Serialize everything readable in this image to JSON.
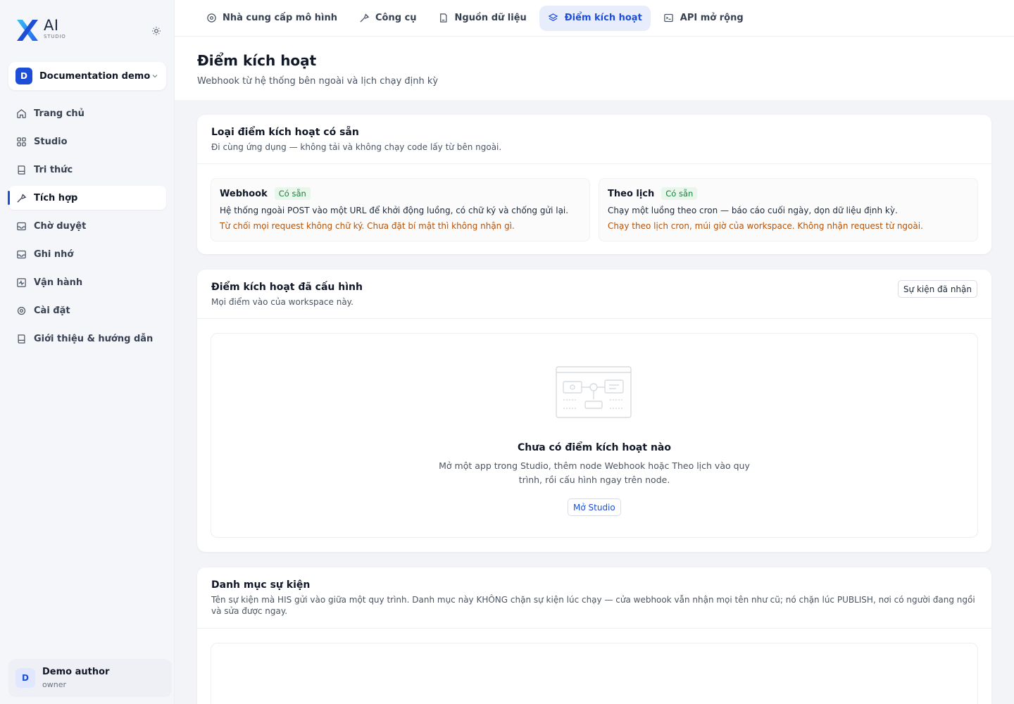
{
  "brand": {
    "name": "AI",
    "sub": "STUDIO"
  },
  "icons": {
    "theme": "sun-icon",
    "chevron": "chevron-down-icon"
  },
  "workspace": {
    "initial": "D",
    "name": "Documentation demo"
  },
  "sidebar": {
    "items": [
      {
        "label": "Trang chủ",
        "icon": "home-icon"
      },
      {
        "label": "Studio",
        "icon": "grid-icon"
      },
      {
        "label": "Tri thức",
        "icon": "book-icon"
      },
      {
        "label": "Tích hợp",
        "icon": "tools-icon",
        "active": true
      },
      {
        "label": "Chờ duyệt",
        "icon": "inbox-icon"
      },
      {
        "label": "Ghi nhớ",
        "icon": "memory-icon"
      },
      {
        "label": "Vận hành",
        "icon": "activity-icon"
      },
      {
        "label": "Cài đặt",
        "icon": "settings-icon"
      },
      {
        "label": "Giới thiệu & hướng dẫn",
        "icon": "guide-icon"
      }
    ]
  },
  "user": {
    "initial": "D",
    "name": "Demo author",
    "role": "owner"
  },
  "tabs": [
    {
      "label": "Nhà cung cấp mô hình",
      "icon": "provider-icon"
    },
    {
      "label": "Công cụ",
      "icon": "tools-icon"
    },
    {
      "label": "Nguồn dữ liệu",
      "icon": "datasource-icon"
    },
    {
      "label": "Điểm kích hoạt",
      "icon": "trigger-icon",
      "active": true
    },
    {
      "label": "API mở rộng",
      "icon": "terminal-icon"
    }
  ],
  "page": {
    "title": "Điểm kích hoạt",
    "subtitle": "Webhook từ hệ thống bên ngoài và lịch chạy định kỳ"
  },
  "available": {
    "title": "Loại điểm kích hoạt có sẵn",
    "subtitle": "Đi cùng ứng dụng — không tải và không chạy code lấy từ bên ngoài.",
    "types": [
      {
        "name": "Webhook",
        "badge": "Có sẵn",
        "desc": "Hệ thống ngoài POST vào một URL để khởi động luồng, có chữ ký và chống gửi lại.",
        "warn": "Từ chối mọi request không chữ ký. Chưa đặt bí mật thì không nhận gì."
      },
      {
        "name": "Theo lịch",
        "badge": "Có sẵn",
        "desc": "Chạy một luồng theo cron — báo cáo cuối ngày, dọn dữ liệu định kỳ.",
        "warn": "Chạy theo lịch cron, múi giờ của workspace. Không nhận request từ ngoài."
      }
    ]
  },
  "configured": {
    "title": "Điểm kích hoạt đã cấu hình",
    "subtitle": "Mọi điểm vào của workspace này.",
    "events_button": "Sự kiện đã nhận",
    "empty": {
      "title": "Chưa có điểm kích hoạt nào",
      "desc": "Mở một app trong Studio, thêm node Webhook hoặc Theo lịch vào quy trình, rồi cấu hình ngay trên node.",
      "button": "Mở Studio"
    }
  },
  "catalog": {
    "title": "Danh mục sự kiện",
    "subtitle": "Tên sự kiện mà HIS gửi vào giữa một quy trình. Danh mục này KHÔNG chặn sự kiện lúc chạy — cửa webhook vẫn nhận mọi tên như cũ; nó chặn lúc PUBLISH, nơi có người đang ngồi và sửa được ngay."
  }
}
